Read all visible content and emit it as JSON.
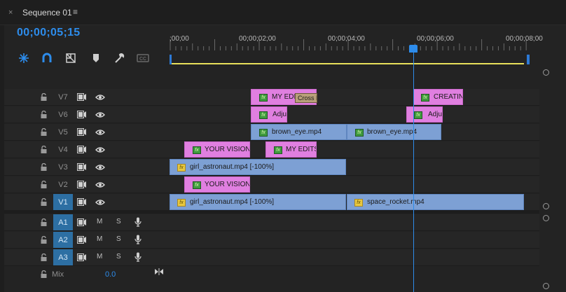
{
  "panel": {
    "close_glyph": "×",
    "sequence_name": "Sequence 01",
    "menu_glyph": "≡",
    "timecode": "00;00;05;15"
  },
  "toolbar": {
    "tools": [
      "snap-icon",
      "linked-selection-icon",
      "add-marker-icon",
      "marker-icon",
      "wrench-icon",
      "captions-icon"
    ]
  },
  "ruler": {
    "ticks": [
      ";00;00",
      "00;00;02;00",
      "00;00;04;00",
      "00;00;06;00",
      "00;00;08;00"
    ]
  },
  "video_tracks": [
    {
      "name": "V7",
      "active": false
    },
    {
      "name": "V6",
      "active": false
    },
    {
      "name": "V5",
      "active": false
    },
    {
      "name": "V4",
      "active": false
    },
    {
      "name": "V3",
      "active": false
    },
    {
      "name": "V2",
      "active": false
    },
    {
      "name": "V1",
      "active": true
    }
  ],
  "audio_tracks": [
    {
      "name": "A1",
      "mute": "M",
      "solo": "S"
    },
    {
      "name": "A2",
      "mute": "M",
      "solo": "S"
    },
    {
      "name": "A3",
      "mute": "M",
      "solo": "S"
    }
  ],
  "mix": {
    "label": "Mix",
    "value": "0.0"
  },
  "clips": {
    "v7_a": "MY EDI",
    "v7_transition": "Cross D",
    "v7_b": "CREATIN",
    "v6_a": "Adju",
    "v6_b": "Adju",
    "v5_a": "brown_eye.mp4",
    "v5_b": "brown_eye.mp4",
    "v4_a": "YOUR VISION",
    "v4_b": "MY EDITS",
    "v3_a": "girl_astronaut.mp4 [-100%]",
    "v2_a": "YOUR VISION",
    "v1_a": "girl_astronaut.mp4 [-100%]",
    "v1_b": "space_rocket.mp4",
    "fx_label": "fx"
  },
  "colors": {
    "accent": "#2d8ceb",
    "graphic_clip": "#e07fe0",
    "video_clip": "#7da0d4",
    "work_area": "#e8e05a"
  }
}
